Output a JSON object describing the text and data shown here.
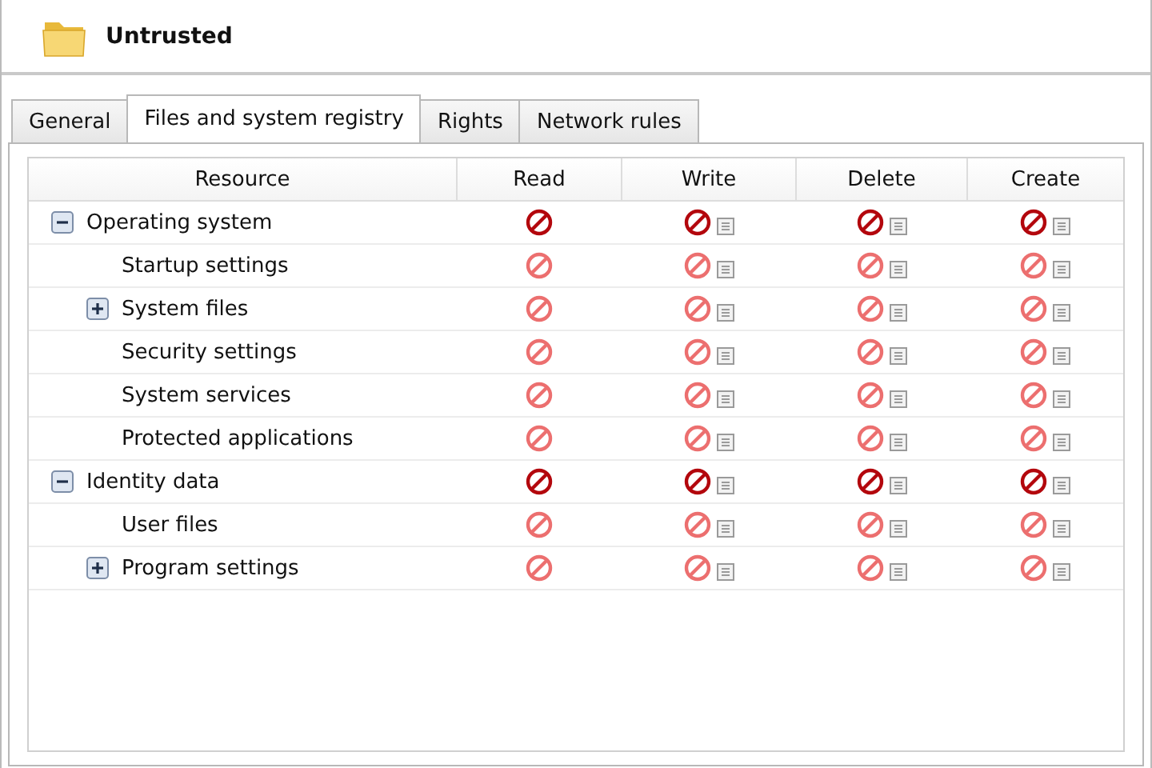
{
  "window": {
    "title": "Untrusted"
  },
  "tabs": [
    {
      "label": "General",
      "selected": false
    },
    {
      "label": "Files and system registry",
      "selected": true
    },
    {
      "label": "Rights",
      "selected": false
    },
    {
      "label": "Network rules",
      "selected": false
    }
  ],
  "table": {
    "columns": [
      {
        "label": "Resource"
      },
      {
        "label": "Read",
        "kind": "access"
      },
      {
        "label": "Write",
        "kind": "access-details"
      },
      {
        "label": "Delete",
        "kind": "access-details"
      },
      {
        "label": "Create",
        "kind": "access-details"
      }
    ],
    "rows": [
      {
        "label": "Operating system",
        "expanded": true,
        "inherited": false,
        "children": [
          {
            "label": "Startup settings",
            "inherited": true
          },
          {
            "label": "System files",
            "expanded": false,
            "inherited": true
          },
          {
            "label": "Security settings",
            "inherited": true
          },
          {
            "label": "System services",
            "inherited": true
          },
          {
            "label": "Protected applications",
            "inherited": true
          }
        ]
      },
      {
        "label": "Identity data",
        "expanded": true,
        "inherited": false,
        "children": [
          {
            "label": "User files",
            "inherited": true
          },
          {
            "label": "Program settings",
            "expanded": false,
            "inherited": true
          }
        ]
      }
    ]
  }
}
